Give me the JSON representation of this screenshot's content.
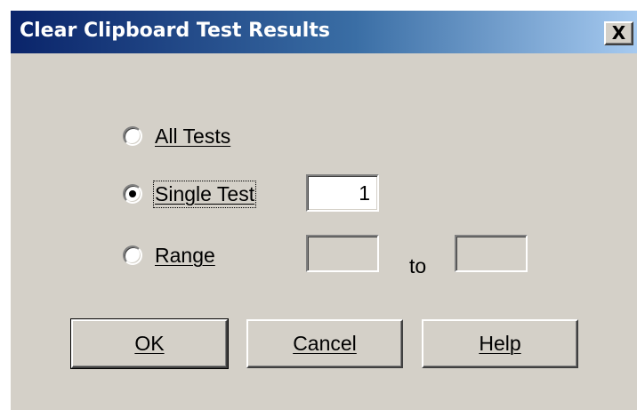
{
  "window": {
    "title": "Clear Clipboard Test Results",
    "close_glyph": "X",
    "background_color": "#d4d0c8",
    "titlebar_color_start": "#0a246a",
    "titlebar_color_end": "#a6caf0"
  },
  "options": {
    "all_tests": {
      "label": "All Tests",
      "checked": false
    },
    "single_test": {
      "label": "Single Test",
      "checked": true,
      "value": "1"
    },
    "range": {
      "label": "Range",
      "checked": false,
      "from_value": "",
      "to_value": "",
      "to_label": "to"
    }
  },
  "buttons": {
    "ok": "OK",
    "cancel": "Cancel",
    "help": "Help"
  }
}
